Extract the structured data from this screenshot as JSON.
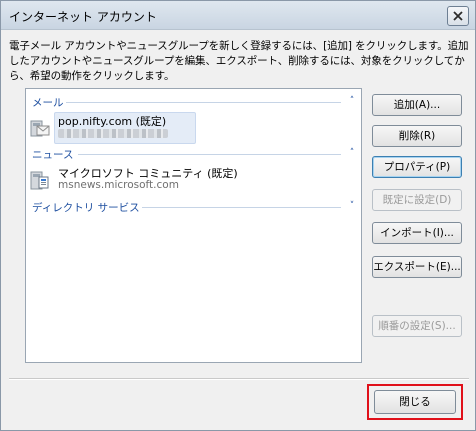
{
  "window": {
    "title": "インターネット アカウント"
  },
  "description": "電子メール アカウントやニュースグループを新しく登録するには、[追加] をクリックします。追加したアカウントやニュースグループを編集、エクスポート、削除するには、対象をクリックしてから、希望の動作をクリックします。",
  "groups": {
    "mail": {
      "label": "メール",
      "accounts": [
        {
          "name": "pop.nifty.com (既定)",
          "icon": "mail-account-icon"
        }
      ]
    },
    "news": {
      "label": "ニュース",
      "accounts": [
        {
          "name": "マイクロソフト コミュニティ (既定)",
          "server": "msnews.microsoft.com",
          "icon": "news-account-icon"
        }
      ]
    },
    "directory": {
      "label": "ディレクトリ サービス"
    }
  },
  "buttons": {
    "add": "追加(A)...",
    "remove": "削除(R)",
    "properties": "プロパティ(P)",
    "set_default": "既定に設定(D)",
    "import": "インポート(I)...",
    "export": "エクスポート(E)...",
    "order": "順番の設定(S)...",
    "close": "閉じる"
  },
  "colors": {
    "group_header": "#1e4fa0",
    "highlight": "#e0101a"
  }
}
